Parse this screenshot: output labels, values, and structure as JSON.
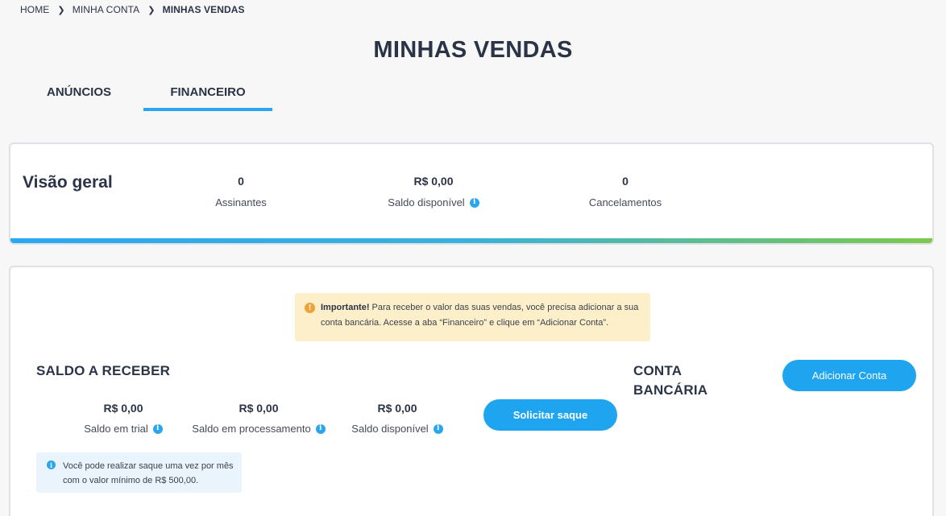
{
  "breadcrumb": {
    "items": [
      "HOME",
      "MINHA CONTA",
      "MINHAS VENDAS"
    ]
  },
  "page": {
    "title": "MINHAS VENDAS"
  },
  "tabs": [
    {
      "label": "ANÚNCIOS",
      "active": false
    },
    {
      "label": "FINANCEIRO",
      "active": true
    }
  ],
  "overview": {
    "title": "Visão geral",
    "stats": [
      {
        "value": "0",
        "label": "Assinantes"
      },
      {
        "value": "R$ 0,00",
        "label": "Saldo disponível"
      },
      {
        "value": "0",
        "label": "Cancelamentos"
      }
    ]
  },
  "notice": {
    "strong": "Importante!",
    "text": " Para receber o valor das suas vendas, você precisa adicionar a sua conta bancária. Acesse a aba “Financeiro” e clique em “Adicionar Conta”."
  },
  "saldo": {
    "title": "SALDO A RECEBER",
    "stats": [
      {
        "value": "R$ 0,00",
        "label": "Saldo em trial"
      },
      {
        "value": "R$ 0,00",
        "label": "Saldo em processamento"
      },
      {
        "value": "R$ 0,00",
        "label": "Saldo disponível"
      }
    ],
    "withdraw_button": "Solicitar saque",
    "tip": "Você pode realizar saque uma vez por mês com o valor mínimo de R$ 500,00."
  },
  "conta": {
    "title": "CONTA BANCÁRIA",
    "add_button": "Adicionar Conta"
  },
  "colors": {
    "accent": "#1fa4f0",
    "text": "#2b3447",
    "notice_bg": "#fdefc9",
    "tip_bg": "#eaf4fc",
    "bar_start": "#29a8f3",
    "bar_end": "#7cc94b"
  }
}
